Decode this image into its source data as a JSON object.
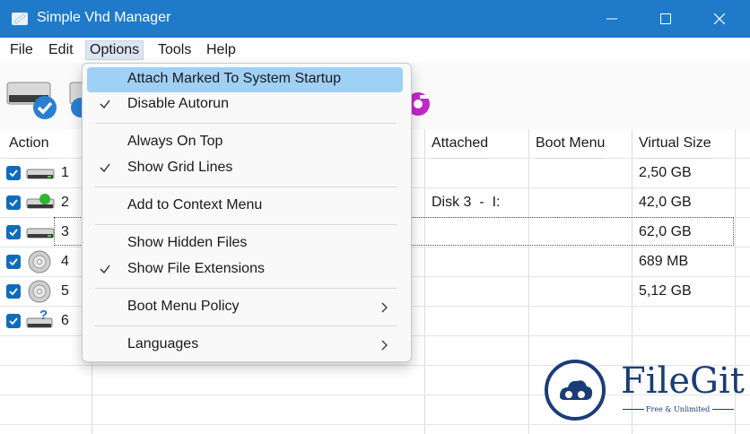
{
  "window": {
    "title": "Simple Vhd Manager",
    "accent": "#1f7ac9"
  },
  "menubar": {
    "items": [
      "File",
      "Edit",
      "Options",
      "Tools",
      "Help"
    ],
    "active": "Options"
  },
  "toolbar": {
    "icons": [
      "drive-attached-icon",
      "drive-icon",
      "purple-badge-icon"
    ]
  },
  "grid": {
    "columns": [
      "Action",
      "Attached",
      "Boot Menu",
      "Virtual Size"
    ],
    "rows": [
      {
        "num": "1",
        "checked": true,
        "icon": "drive-icon",
        "attached": "",
        "boot": "",
        "size": "2,50 GB"
      },
      {
        "num": "2",
        "checked": true,
        "icon": "drive-attached-green-icon",
        "attached": "Disk 3  -  I:",
        "boot": "",
        "size": "42,0 GB"
      },
      {
        "num": "3",
        "checked": true,
        "icon": "drive-icon",
        "attached": "",
        "boot": "",
        "size": "62,0 GB"
      },
      {
        "num": "4",
        "checked": true,
        "icon": "disc-icon",
        "attached": "",
        "boot": "",
        "size": "689 MB"
      },
      {
        "num": "5",
        "checked": true,
        "icon": "disc-icon",
        "attached": "",
        "boot": "",
        "size": "5,12 GB"
      },
      {
        "num": "6",
        "checked": true,
        "icon": "drive-unknown-icon",
        "attached": "",
        "boot": "",
        "size": ""
      }
    ]
  },
  "options_menu": {
    "items": [
      {
        "label": "Attach Marked To System Startup",
        "checked": false,
        "highlighted": true
      },
      {
        "label": "Disable Autorun",
        "checked": true
      },
      {
        "label": "Always On Top",
        "checked": false
      },
      {
        "label": "Show Grid Lines",
        "checked": true
      },
      {
        "label": "Add to Context Menu",
        "checked": false
      },
      {
        "label": "Show Hidden Files",
        "checked": false
      },
      {
        "label": "Show File Extensions",
        "checked": true
      },
      {
        "label": "Boot Menu Policy",
        "submenu": true
      },
      {
        "label": "Languages",
        "submenu": true
      }
    ]
  },
  "watermark": {
    "brand": "FileGit",
    "tagline": "Free & Unlimited",
    "color": "#1a3d78"
  }
}
